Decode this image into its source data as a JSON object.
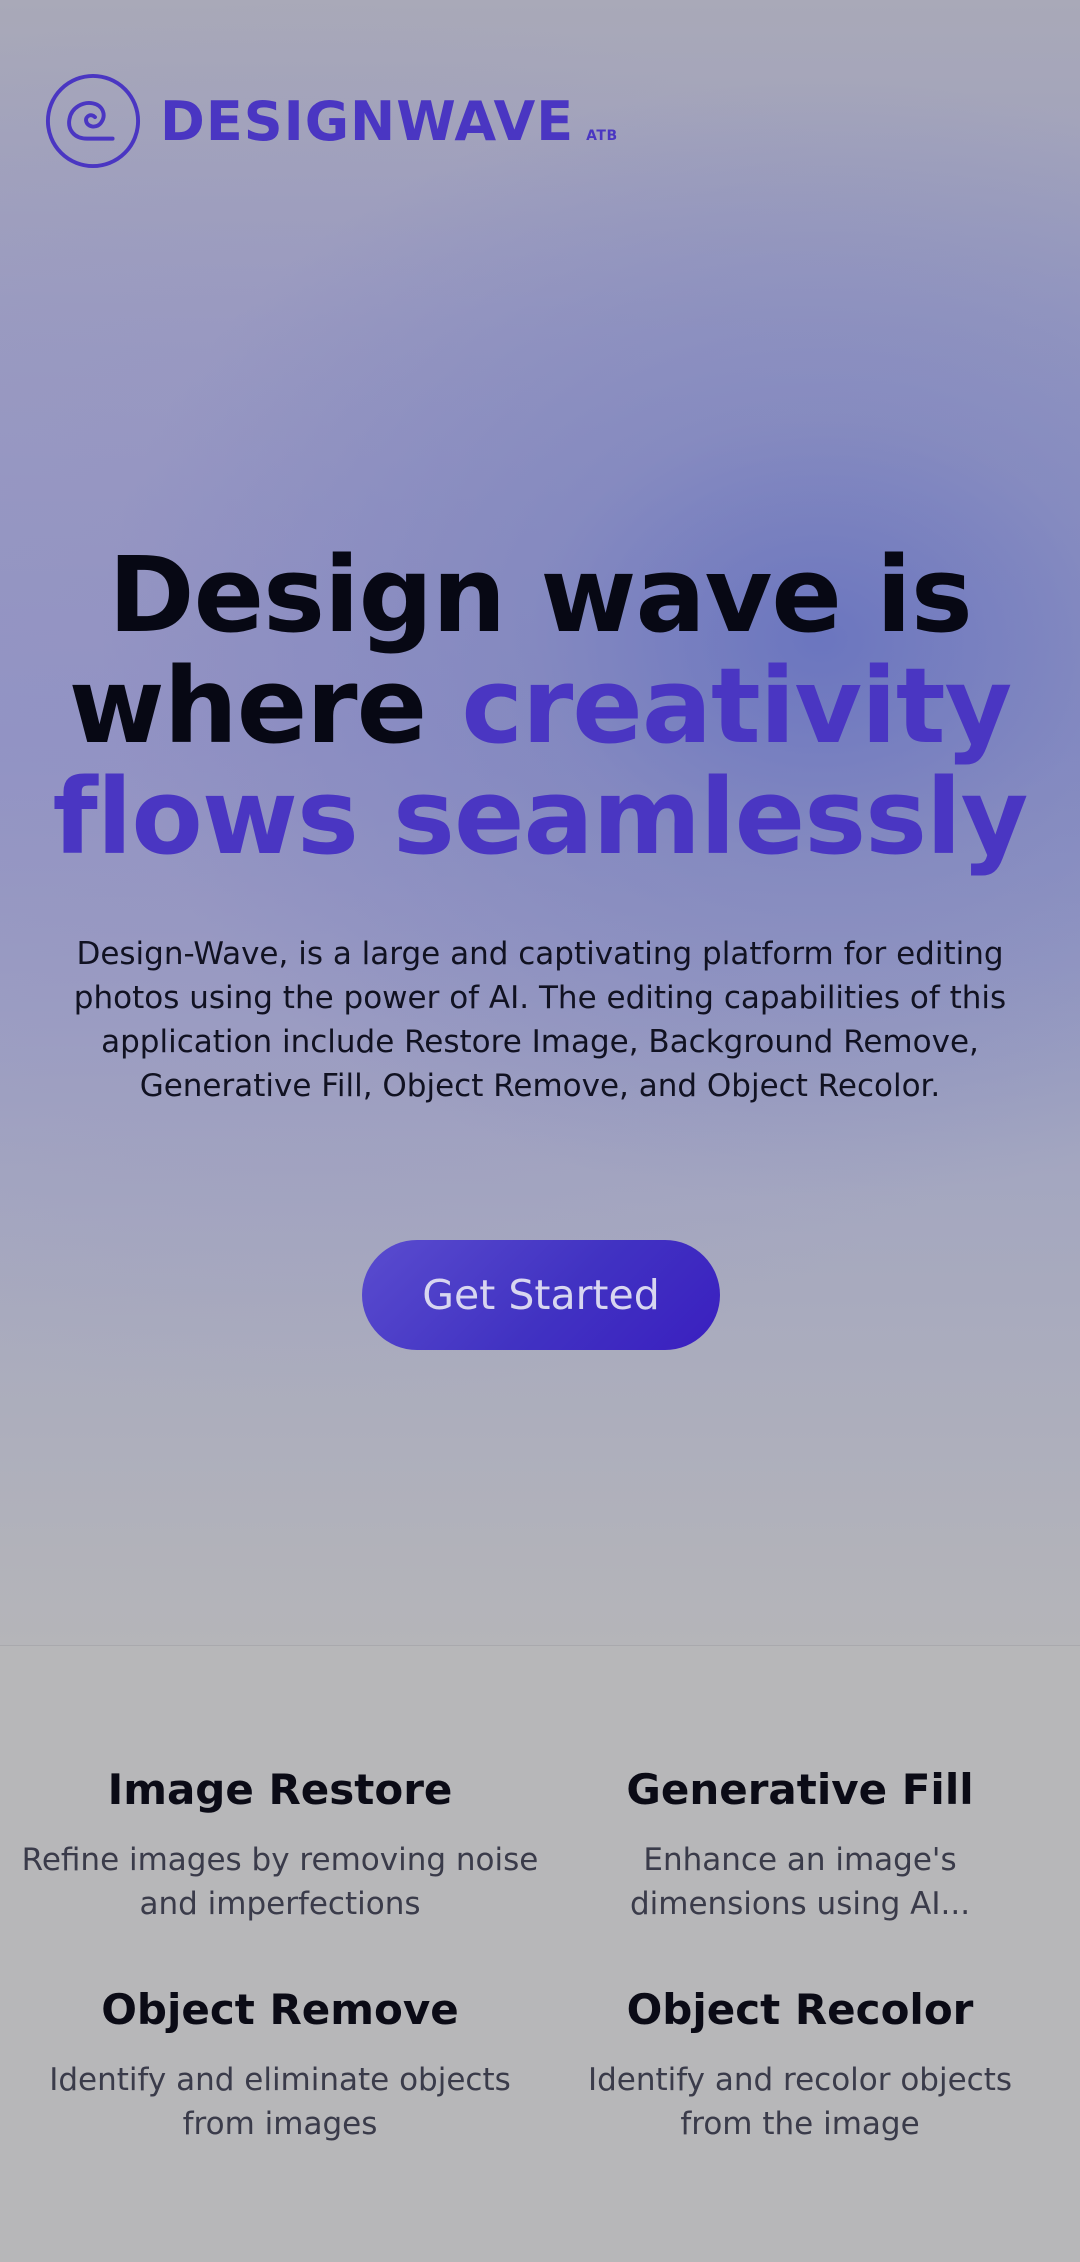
{
  "brand": {
    "name": "DESIGNWAVE",
    "suffix": "ATB",
    "logo_icon": "wave-circle-icon",
    "color": "#4a36c2"
  },
  "hero": {
    "headline_line1": "Design wave is",
    "headline_where": "where",
    "headline_accent_1": "creativity",
    "headline_accent_2": "flows seamlessly",
    "description": "Design-Wave, is a large and captivating platform for editing photos using the power of AI. The editing capabilities of this application include Restore Image, Background Remove, Generative Fill, Object Remove, and Object Recolor.",
    "cta_label": "Get Started"
  },
  "features": [
    {
      "title": "Image Restore",
      "text": "Refine images by removing noise and imperfections"
    },
    {
      "title": "Generative Fill",
      "text": "Enhance an image's dimensions using AI..."
    },
    {
      "title": "Object Remove",
      "text": "Identify and eliminate objects from images"
    },
    {
      "title": "Object Recolor",
      "text": "Identify and recolor objects from the image"
    }
  ],
  "colors": {
    "accent": "#4a36c2",
    "text_dark": "#070814",
    "footer_bg": "#b7b7b9"
  }
}
